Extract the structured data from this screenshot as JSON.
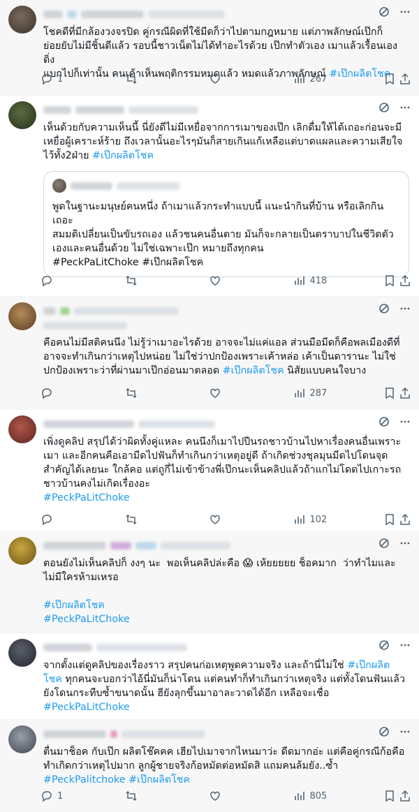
{
  "posts": [
    {
      "lines": [
        [
          {
            "t": "โชคดีที่มีกล้องวงจรปิด คู่กรณีผิดที่ใช้มีดก็ว่าไปตามกฎหมาย แต่ภาพลักษณ์เป๊กก็"
          }
        ],
        [
          {
            "t": "ย่อยยับไม่มีชิ้นดีแล้ว รอบนี้ชาวเน็ตไม่ได้ทำอะไรด้วย เป๊กทำตัวเอง เมาแล้วเรื้อนเอง ดิ่ง"
          }
        ],
        [
          {
            "t": "แบกไปก็เท่านั้น คนเค้าเห็นพฤติกรรมหมดแล้ว หมดแล้วภาพลักษณ์ "
          },
          {
            "t": "#เป๊กผลิตโชค",
            "tag": true
          }
        ]
      ],
      "reply_count": "1",
      "repost_count": "",
      "like_count": "",
      "view_count": "267"
    },
    {
      "lines": [
        [
          {
            "t": "เห็นด้วยกับความเห็นนี้ นี่ยังดีไม่มีเหยื่อจากการเมาของเป๊ก เลิกดื่มให้ได้เถอะก่อนจะมี"
          }
        ],
        [
          {
            "t": "เหยื่อผู้เคราะห์ร้าย ถึงเวลานั้นอะไรๆมันก็สายเกินแก้เหลือแต่บาดแผลและความเสียใจ"
          }
        ],
        [
          {
            "t": "ไว้ทั้ง2ฝ่าย "
          },
          {
            "t": "#เป๊กผลิตโชค",
            "tag": true
          }
        ]
      ],
      "quote": {
        "lines": [
          [
            {
              "t": "พูดในฐานะมนุษย์คนหนึ่ง ถ้าเมาแล้วกระทำแบบนี้ แนะนำกินที่บ้าน หรือเลิกกินเถอะ"
            }
          ],
          [
            {
              "t": "สมมติเปลี่ยนเป็นขับรถเอง แล้วชนคนอื่นตาย มันก็จะกลายเป็นตราบาปในชีวิตตัว"
            }
          ],
          [
            {
              "t": "เองและคนอื่นด้วย ไม่ใช่เฉพาะเป๊ก หมายถึงทุกคน"
            }
          ],
          [
            {
              "t": "#PeckPaLitChoke #เป๊กผลิตโชค"
            }
          ]
        ]
      },
      "reply_count": "",
      "repost_count": "",
      "like_count": "",
      "view_count": "418"
    },
    {
      "lines": [
        [
          {
            "t": "คือคนไม่มีสติคนนึง ไม่รู้ว่าเมาอะไรด้วย อาจจะไม่แค่แอล ส่วนมือมีดก็คือพลเมืองดีที่"
          }
        ],
        [
          {
            "t": "อาจจะทำเกินกว่าเหตุไปหน่อย ไม่ใช่ว่าปกป้องเพราะเค้าหล่อ เค้าเป็นดารานะ ไม่ใช่"
          }
        ],
        [
          {
            "t": "ปกป้องเพราะว่าที่ผ่านมาเป๊กอ่อนมาตลอด "
          },
          {
            "t": "#เป๊กผลิตโชค",
            "tag": true
          },
          {
            "t": " นิสัยแบบคนใจบาง"
          }
        ]
      ],
      "reply_count": "",
      "repost_count": "",
      "like_count": "",
      "view_count": "287"
    },
    {
      "lines": [
        [
          {
            "t": "เพิ่งดูคลิป สรุปได้ว่าผิดทั้งคู่แหละ คนนึงก็เมาไปปีนรถชาวบ้านไปหาเรื่องคนอื่นเพราะ"
          }
        ],
        [
          {
            "t": "เมา และอีกคนคือเอามีดไปฟันก็ทำเกินกว่าเหตุอยู่ดี ถ้าเกิดช่วงชุลมุนมีดไปโดนจุด"
          }
        ],
        [
          {
            "t": "สำคัญได้เลยนะ ใกล้คอ แต่ถูกี่ไม่เข้าข้างพี่เป๊กนะเห็นคลิปแล้วถ้าแกไม่โดดไปเกาะรถ"
          }
        ],
        [
          {
            "t": "ชาวบ้านคงไม่เกิดเรื่องอะ"
          }
        ],
        [
          {
            "t": "#PeckPaLitChoke",
            "tag": true
          }
        ]
      ],
      "reply_count": "",
      "repost_count": "",
      "like_count": "",
      "view_count": "102"
    },
    {
      "lines": [
        [
          {
            "t": "ตอนยังไม่เห็นคลิปก็ งงๆ นะ  พอเห็นคลิปล่ะคือ 😱 เห้ยยยยย ช็อคมาก  ว่าทำไมและ"
          }
        ],
        [
          {
            "t": "ไม่มีใครห้ามเหรอ"
          }
        ],
        [
          {
            "t": ""
          }
        ],
        [
          {
            "t": "#เป๊กผลิตโชค",
            "tag": true
          }
        ],
        [
          {
            "t": "#PeckPaLitChoke",
            "tag": true
          }
        ]
      ]
    },
    {
      "lines": [
        [
          {
            "t": "จากตั้งแต่ดูคลิปของเรื่องราว สรุปคนก่อเหตุพูดความจริง และถ้านี่ไม่ใช่ "
          },
          {
            "t": "#เป๊กผลิต",
            "tag": true
          }
        ],
        [
          {
            "t": "โชค",
            "tag": true
          },
          {
            "t": " ทุกคนจะบอกว่าไอ้นี่มันก็น่าโดน แต่คนทำก็ทำเกินกว่าเหตุจริง แต่ทั้งโดนฟันแล้ว"
          }
        ],
        [
          {
            "t": "ยังโดนกระทืบซ้ำขนาดนั้น ฮียังลุกขึ้นมาอาละวาดได้อีก เหลือจะเชื่อ"
          }
        ],
        [
          {
            "t": "#PeckPaLitChoke",
            "tag": true
          }
        ]
      ]
    },
    {
      "lines": [
        [
          {
            "t": "ตื่นมาช็อค กับเป๊ก ผลิตโช๊คคค เฮียไปเมาจากไหนมาว่ะ ดีดมากอ่ะ แต่คือคู่กรณีก้อคือ"
          }
        ],
        [
          {
            "t": "ทำเกิดกว่าเหตุไปมาก ลูกผู้ชายจริงก้อหมัดต่อหมัดสิ แถมคนล้มยัง..ซ้ำ"
          }
        ],
        [
          {
            "t": "#PeckPalitchoke #เป๊กผลิตโชค",
            "tag": true
          }
        ]
      ],
      "reply_count": "1",
      "repost_count": "",
      "like_count": "",
      "view_count": "805"
    }
  ],
  "colors": {
    "accent": "#1d9bf0",
    "muted": "#536471",
    "text": "#0f1419"
  },
  "icons": [
    "grok-icon",
    "more-icon",
    "reply-icon",
    "repost-icon",
    "like-icon",
    "views-icon",
    "bookmark-icon",
    "share-icon"
  ]
}
